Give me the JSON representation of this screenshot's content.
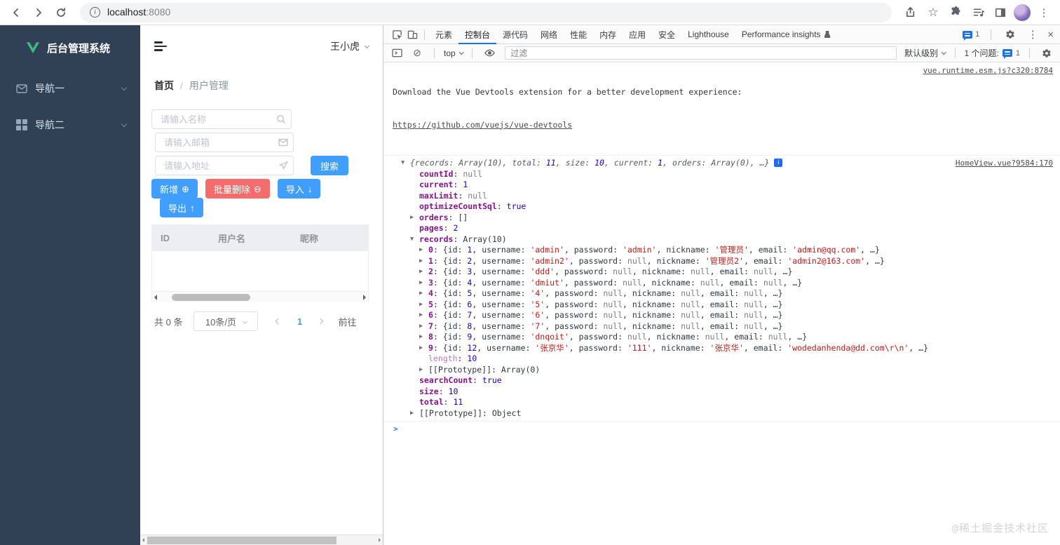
{
  "colors": {
    "accent": "#409eff",
    "danger": "#f56c6c",
    "sidebar_bg": "#304156",
    "devtools_accent": "#1a73e8",
    "key_purple": "#881391",
    "string_red": "#c41a16",
    "number_blue": "#1c00cf"
  },
  "browser": {
    "url_host": "localhost",
    "url_port": ":8080"
  },
  "app": {
    "sidebar": {
      "logo_text": "后台管理系统",
      "items": [
        {
          "icon": "envelope-icon",
          "label": "导航一"
        },
        {
          "icon": "grid-icon",
          "label": "导航二"
        }
      ]
    },
    "header": {
      "user_name": "王小虎"
    },
    "breadcrumb": {
      "home": "首页",
      "separator": "/",
      "current": "用户管理"
    },
    "search": {
      "name_placeholder": "请输入名称",
      "email_placeholder": "请输入邮箱",
      "address_placeholder": "请输入地址",
      "search_button": "搜索"
    },
    "actions": {
      "add": "新增",
      "add_icon": "⊕",
      "batch_delete": "批量删除",
      "delete_icon": "⊖",
      "import": "导入",
      "import_icon": "↓",
      "export": "导出",
      "export_icon": "↑"
    },
    "table": {
      "columns": [
        "ID",
        "用户名",
        "昵称"
      ]
    },
    "pagination": {
      "total_text": "共 0 条",
      "page_size": "10条/页",
      "current_page": "1",
      "goto_label": "前往"
    }
  },
  "devtools": {
    "tabs": [
      {
        "label": "元素"
      },
      {
        "label": "控制台",
        "active": true
      },
      {
        "label": "源代码"
      },
      {
        "label": "网络"
      },
      {
        "label": "性能"
      },
      {
        "label": "内存"
      },
      {
        "label": "应用"
      },
      {
        "label": "安全"
      },
      {
        "label": "Lighthouse"
      },
      {
        "label": "Performance insights",
        "trailing_icon": "flask-icon"
      }
    ],
    "tabbar_right": {
      "messages_count": "1"
    },
    "toolbar": {
      "context": "top",
      "filter_placeholder": "过滤",
      "levels": "默认级别",
      "issues_label": "1 个问题:",
      "issues_count": "1"
    },
    "console": {
      "vue_message": {
        "line1": "Download the Vue Devtools extension for a better development experience:",
        "link": "https://github.com/vuejs/vue-devtools",
        "source": "vue.runtime.esm.js?c320:8784"
      },
      "log_source": "HomeView.vue?9584:170",
      "preview_segs": [
        [
          "pv",
          "{records: Array(10), total: "
        ],
        [
          "pvn",
          "11"
        ],
        [
          "pv",
          ", size: "
        ],
        [
          "pvn",
          "10"
        ],
        [
          "pv",
          ", current: "
        ],
        [
          "pvn",
          "1"
        ],
        [
          "pv",
          ", orders: Array(0), …}"
        ]
      ],
      "structure": [
        {
          "ind": 0,
          "arr": "v",
          "preview": true
        },
        {
          "ind": 1,
          "segs": [
            [
              "k",
              "countId"
            ],
            [
              "p",
              ": "
            ],
            [
              "u",
              "null"
            ]
          ]
        },
        {
          "ind": 1,
          "segs": [
            [
              "k",
              "current"
            ],
            [
              "p",
              ": "
            ],
            [
              "n",
              "1"
            ]
          ]
        },
        {
          "ind": 1,
          "segs": [
            [
              "k",
              "maxLimit"
            ],
            [
              "p",
              ": "
            ],
            [
              "u",
              "null"
            ]
          ]
        },
        {
          "ind": 1,
          "segs": [
            [
              "k",
              "optimizeCountSql"
            ],
            [
              "p",
              ": "
            ],
            [
              "b",
              "true"
            ]
          ]
        },
        {
          "ind": 1,
          "arr": "r",
          "segs": [
            [
              "k",
              "orders"
            ],
            [
              "p",
              ": []"
            ]
          ]
        },
        {
          "ind": 1,
          "segs": [
            [
              "k",
              "pages"
            ],
            [
              "p",
              ": "
            ],
            [
              "n",
              "2"
            ]
          ]
        },
        {
          "ind": 1,
          "arr": "v",
          "segs": [
            [
              "k",
              "records"
            ],
            [
              "p",
              ": Array(10)"
            ]
          ]
        },
        {
          "records_here": true
        },
        {
          "ind": 2,
          "segs": [
            [
              "kd",
              "length"
            ],
            [
              "p",
              ": "
            ],
            [
              "n",
              "10"
            ]
          ]
        },
        {
          "ind": 2,
          "arr": "r",
          "segs": [
            [
              "p",
              "[[Prototype]]: Array(0)"
            ]
          ]
        },
        {
          "ind": 1,
          "segs": [
            [
              "k",
              "searchCount"
            ],
            [
              "p",
              ": "
            ],
            [
              "b",
              "true"
            ]
          ]
        },
        {
          "ind": 1,
          "segs": [
            [
              "k",
              "size"
            ],
            [
              "p",
              ": "
            ],
            [
              "n",
              "10"
            ]
          ]
        },
        {
          "ind": 1,
          "segs": [
            [
              "k",
              "total"
            ],
            [
              "p",
              ": "
            ],
            [
              "n",
              "11"
            ]
          ]
        },
        {
          "ind": 1,
          "arr": "r",
          "segs": [
            [
              "p",
              "[[Prototype]]: Object"
            ]
          ]
        }
      ],
      "records": [
        {
          "index": "0",
          "id": "1",
          "username": "admin",
          "password": "admin",
          "nickname": "管理员",
          "email": "admin@qq.com"
        },
        {
          "index": "1",
          "id": "2",
          "username": "admin2",
          "password": null,
          "nickname": "管理员2",
          "email": "admin2@163.com"
        },
        {
          "index": "2",
          "id": "3",
          "username": "ddd",
          "password": null,
          "nickname": null,
          "email": null
        },
        {
          "index": "3",
          "id": "4",
          "username": "dmiut",
          "password": null,
          "nickname": null,
          "email": null
        },
        {
          "index": "4",
          "id": "5",
          "username": "4",
          "password": null,
          "nickname": null,
          "email": null
        },
        {
          "index": "5",
          "id": "6",
          "username": "5",
          "password": null,
          "nickname": null,
          "email": null
        },
        {
          "index": "6",
          "id": "7",
          "username": "6",
          "password": null,
          "nickname": null,
          "email": null
        },
        {
          "index": "7",
          "id": "8",
          "username": "7",
          "password": null,
          "nickname": null,
          "email": null
        },
        {
          "index": "8",
          "id": "9",
          "username": "dnqoit",
          "password": null,
          "nickname": null,
          "email": null
        },
        {
          "index": "9",
          "id": "12",
          "username": "张京华",
          "password": "111",
          "nickname": "张京华",
          "email": "wodedanhenda@dd.com\\r\\n"
        }
      ]
    }
  },
  "watermark": "@稀土掘金技术社区"
}
